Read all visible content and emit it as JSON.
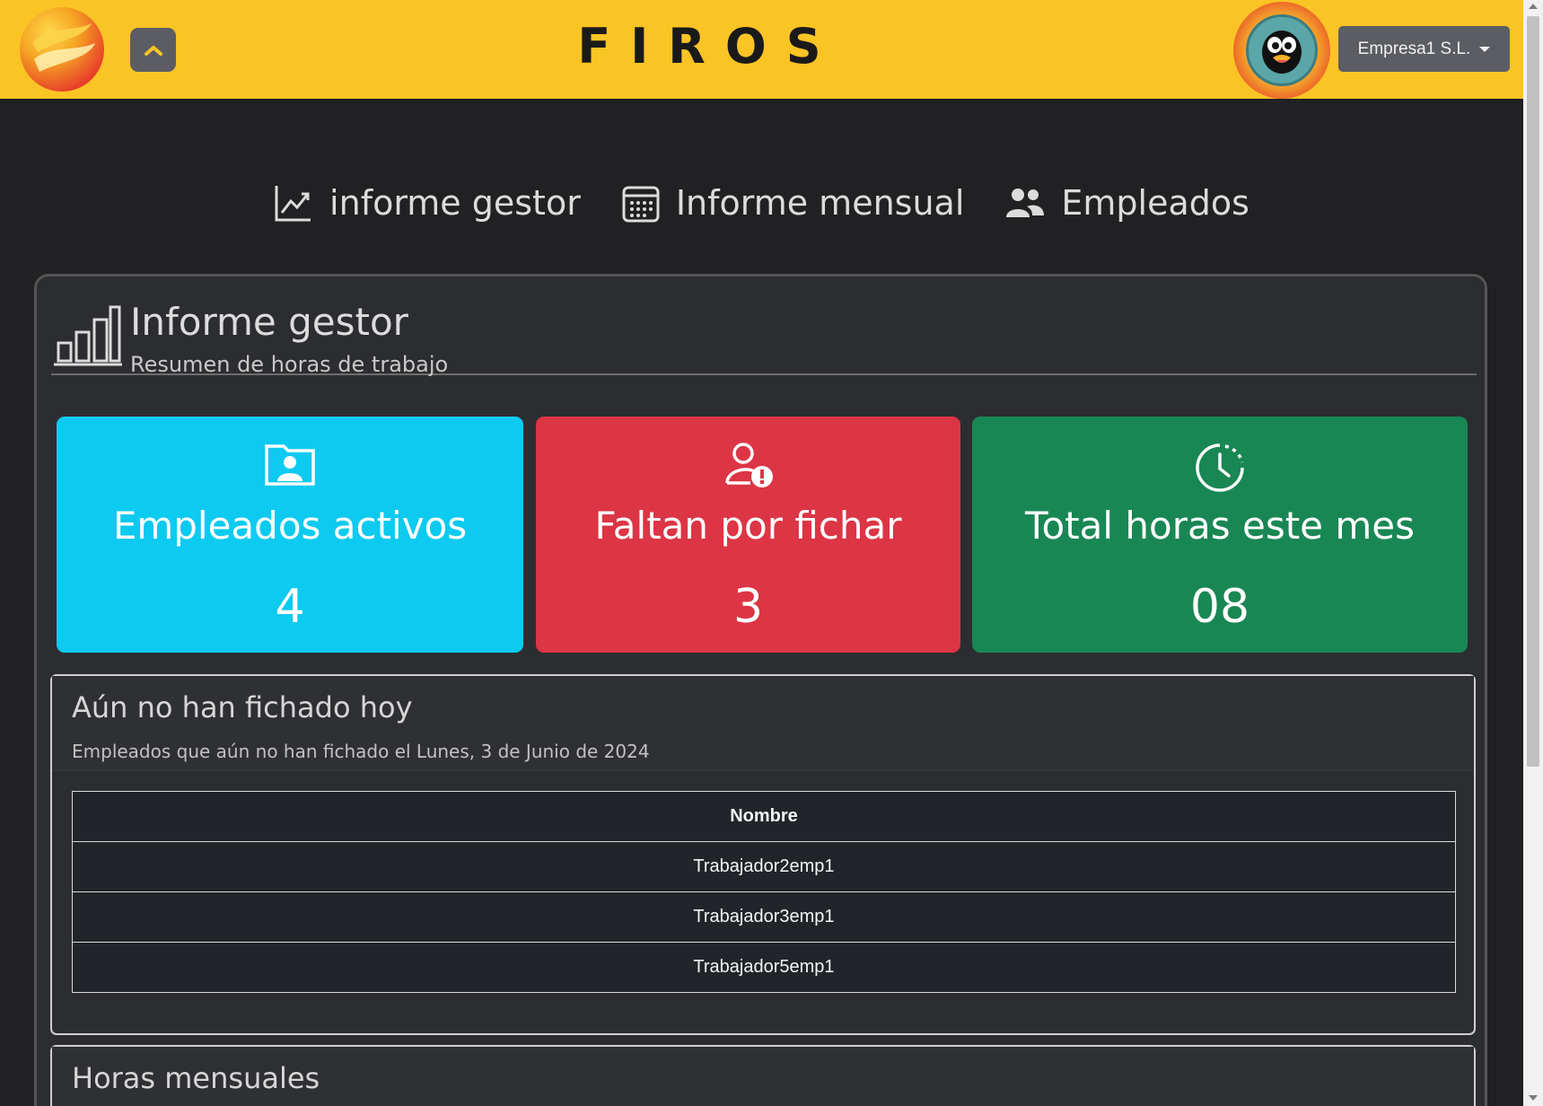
{
  "header": {
    "brand": "FIROS",
    "company_menu_label": "Empresa1 S.L."
  },
  "nav": {
    "items": [
      {
        "label": "informe gestor",
        "icon": "chart-line-icon"
      },
      {
        "label": "Informe mensual",
        "icon": "calendar-icon"
      },
      {
        "label": "Empleados",
        "icon": "users-icon"
      }
    ]
  },
  "main": {
    "title": "Informe gestor",
    "subtitle": "Resumen de horas de trabajo",
    "stats": [
      {
        "label": "Empleados activos",
        "value": "4",
        "color": "#0dcaf0",
        "icon": "person-id-icon"
      },
      {
        "label": "Faltan por fichar",
        "value": "3",
        "color": "#dc3545",
        "icon": "person-alert-icon"
      },
      {
        "label": "Total horas este mes",
        "value": "08",
        "color": "#198754",
        "icon": "clock-icon"
      }
    ],
    "pending_card": {
      "title": "Aún no han fichado hoy",
      "description": "Empleados que aún no han fichado el Lunes, 3 de Junio de 2024",
      "table": {
        "headers": [
          "Nombre"
        ],
        "rows": [
          "Trabajador2emp1",
          "Trabajador3emp1",
          "Trabajador5emp1"
        ]
      }
    },
    "monthly_card": {
      "title": "Horas mensuales"
    }
  },
  "colors": {
    "topbar": "#fbc425",
    "background": "#212123",
    "card": "#2c2d30"
  }
}
